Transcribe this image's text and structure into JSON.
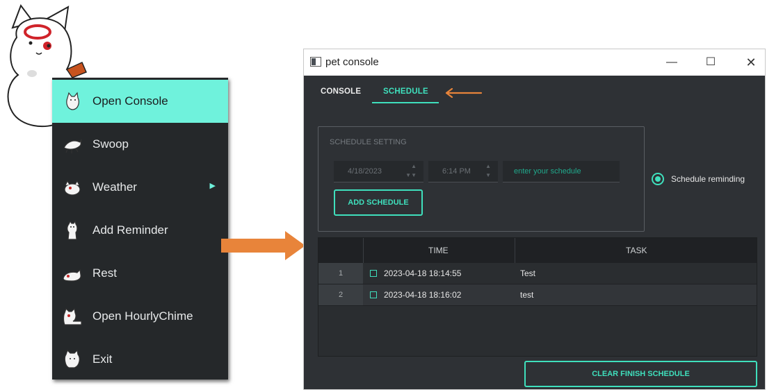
{
  "context_menu": {
    "items": [
      {
        "label": "Open Console",
        "icon": "cat-sitting-icon",
        "active": true
      },
      {
        "label": "Swoop",
        "icon": "cat-pounce-icon"
      },
      {
        "label": "Weather",
        "icon": "cat-weather-icon",
        "submenu": true
      },
      {
        "label": "Add Reminder",
        "icon": "cat-standing-icon"
      },
      {
        "label": "Rest",
        "icon": "cat-sleeping-icon"
      },
      {
        "label": "Open HourlyChime",
        "icon": "cat-chime-icon"
      },
      {
        "label": "Exit",
        "icon": "cat-exit-icon"
      }
    ],
    "submenu_arrow": "▶"
  },
  "window": {
    "title": "pet console",
    "controls": {
      "minimize": "—",
      "maximize": "☐",
      "close": "✕"
    }
  },
  "tabs": {
    "console": "CONSOLE",
    "schedule": "SCHEDULE",
    "active": "schedule"
  },
  "schedule_setting": {
    "legend": "SCHEDULE SETTING",
    "date": "4/18/2023",
    "time": "6:14 PM",
    "task_placeholder": "enter your schedule",
    "add_button": "ADD SCHEDULE"
  },
  "reminding": {
    "label": "Schedule reminding",
    "checked": true
  },
  "table": {
    "headers": {
      "time": "TIME",
      "task": "TASK"
    },
    "rows": [
      {
        "index": "1",
        "time": "2023-04-18 18:14:55",
        "task": "Test"
      },
      {
        "index": "2",
        "time": "2023-04-18 18:16:02",
        "task": "test"
      }
    ]
  },
  "clear_button": "CLEAR FINISH SCHEDULE",
  "colors": {
    "accent": "#3fe0bd",
    "menu_highlight": "#6ff2dc",
    "menu_bg": "#25282a",
    "window_bg": "#2e3135",
    "arrow": "#e8843a"
  }
}
